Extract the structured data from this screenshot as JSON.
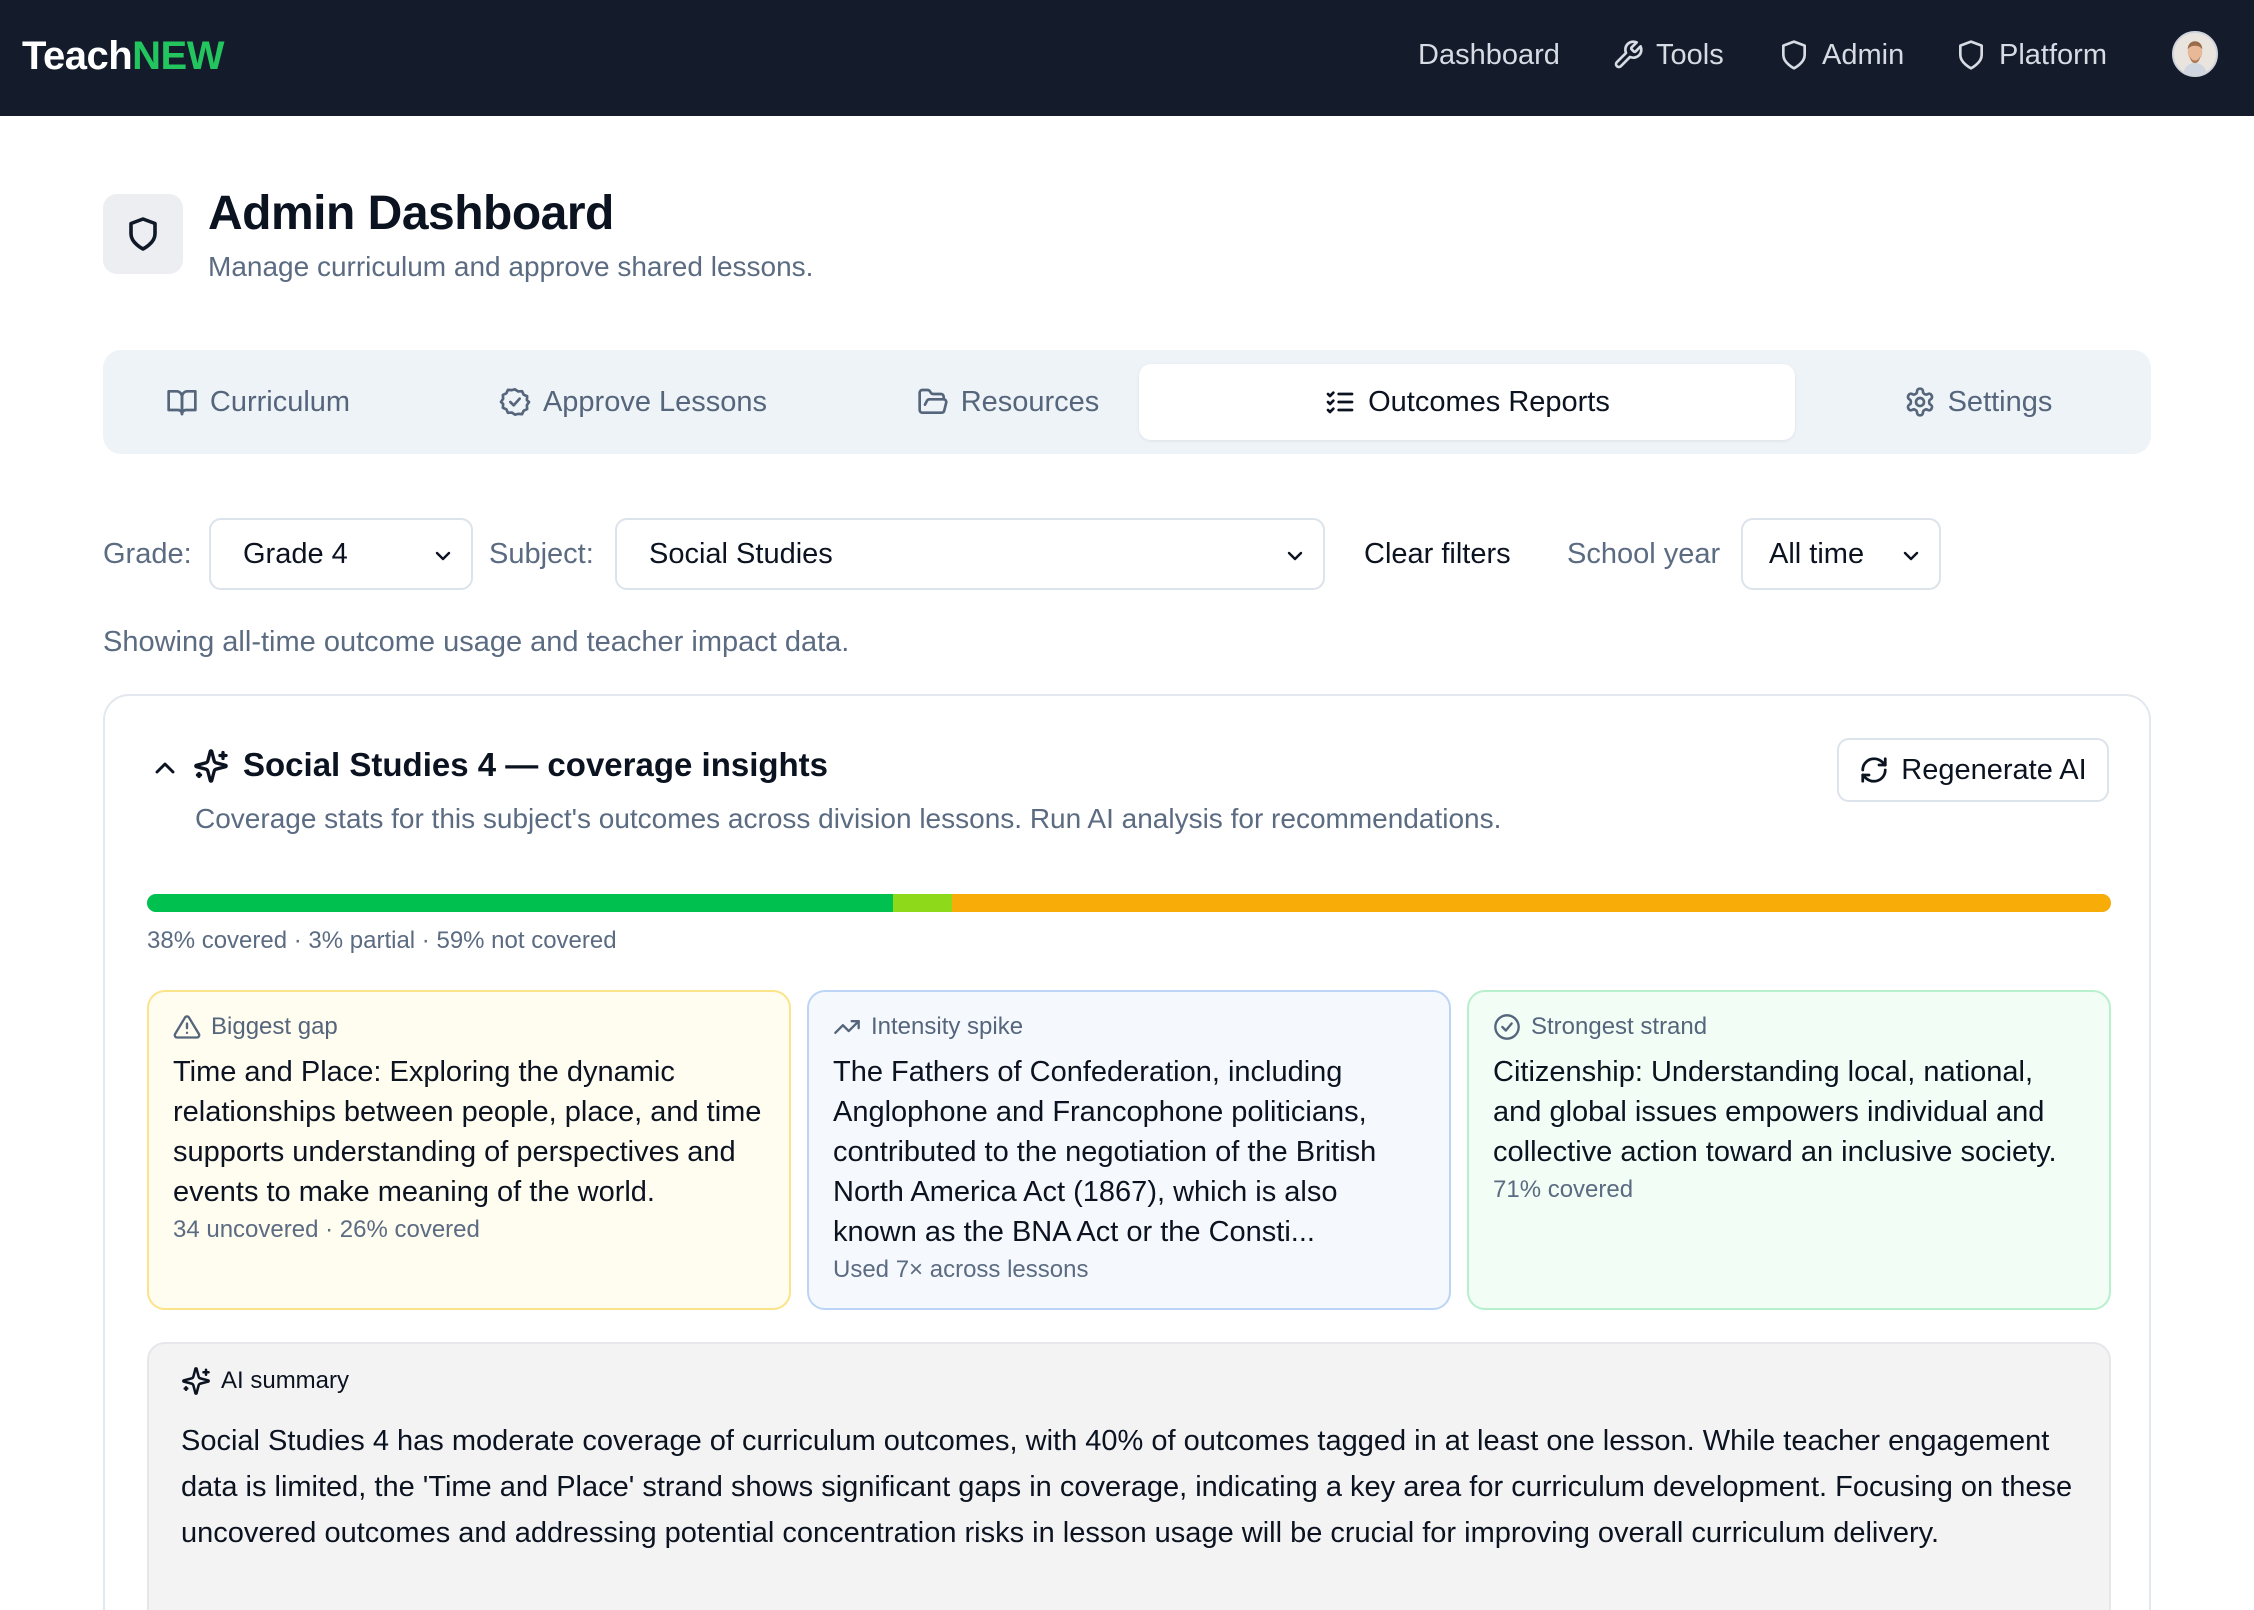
{
  "brand": {
    "part1": "Teach",
    "part2": "NEW",
    "accent": "#22c55e"
  },
  "nav": {
    "dashboard": "Dashboard",
    "tools": "Tools",
    "admin": "Admin",
    "platform": "Platform",
    "icons": {
      "tools": "wrench-icon",
      "admin": "shield-icon",
      "platform": "shield-icon"
    }
  },
  "header": {
    "title": "Admin Dashboard",
    "subtitle": "Manage curriculum and approve shared lessons.",
    "icon": "shield-icon"
  },
  "tabs": [
    {
      "label": "Curriculum",
      "icon": "book-open-icon",
      "active": false
    },
    {
      "label": "Approve Lessons",
      "icon": "check-circle-icon",
      "active": false
    },
    {
      "label": "Resources",
      "icon": "folder-open-icon",
      "active": false
    },
    {
      "label": "Outcomes Reports",
      "icon": "list-checks-icon",
      "active": true
    },
    {
      "label": "Settings",
      "icon": "gear-icon",
      "active": false
    }
  ],
  "filters": {
    "grade_label": "Grade:",
    "grade_value": "Grade 4",
    "subject_label": "Subject:",
    "subject_value": "Social Studies",
    "clear_label": "Clear filters",
    "year_label": "School year",
    "year_value": "All time"
  },
  "showing_text": "Showing all-time outcome usage and teacher impact data.",
  "card": {
    "title": "Social Studies 4 — coverage insights",
    "subtitle": "Coverage stats for this subject's outcomes across division lessons. Run AI analysis for recommendations.",
    "regenerate_label": "Regenerate AI",
    "coverage": {
      "covered_pct": 38,
      "partial_pct": 3,
      "not_covered_pct": 59,
      "colors": {
        "covered": "#00c050",
        "partial": "#8ed91a",
        "not_covered": "#f8ac08"
      },
      "caption": "38% covered · 3% partial · 59% not covered"
    },
    "insights": {
      "gap": {
        "label": "Biggest gap",
        "icon": "warning-triangle-icon",
        "body": "Time and Place: Exploring the dynamic relationships between people, place, and time supports understanding of perspectives and events to make meaning of the world.",
        "meta": "34 uncovered · 26% covered"
      },
      "spike": {
        "label": "Intensity spike",
        "icon": "trending-up-icon",
        "body": "The Fathers of Confederation, including Anglophone and Francophone politicians, contributed to the negotiation of the British North America Act (1867), which is also known as the BNA Act or the Consti...",
        "meta": "Used 7× across lessons"
      },
      "strong": {
        "label": "Strongest strand",
        "icon": "check-circle-icon",
        "body": "Citizenship: Understanding local, national, and global issues empowers individual and collective action toward an inclusive society.",
        "meta": "71% covered"
      }
    },
    "summary": {
      "label": "AI summary",
      "body": "Social Studies 4 has moderate coverage of curriculum outcomes, with 40% of outcomes tagged in at least one lesson. While teacher engagement data is limited, the 'Time and Place' strand shows significant gaps in coverage, indicating a key area for curriculum development. Focusing on these uncovered outcomes and addressing potential concentration risks in lesson usage will be crucial for improving overall curriculum delivery."
    }
  }
}
